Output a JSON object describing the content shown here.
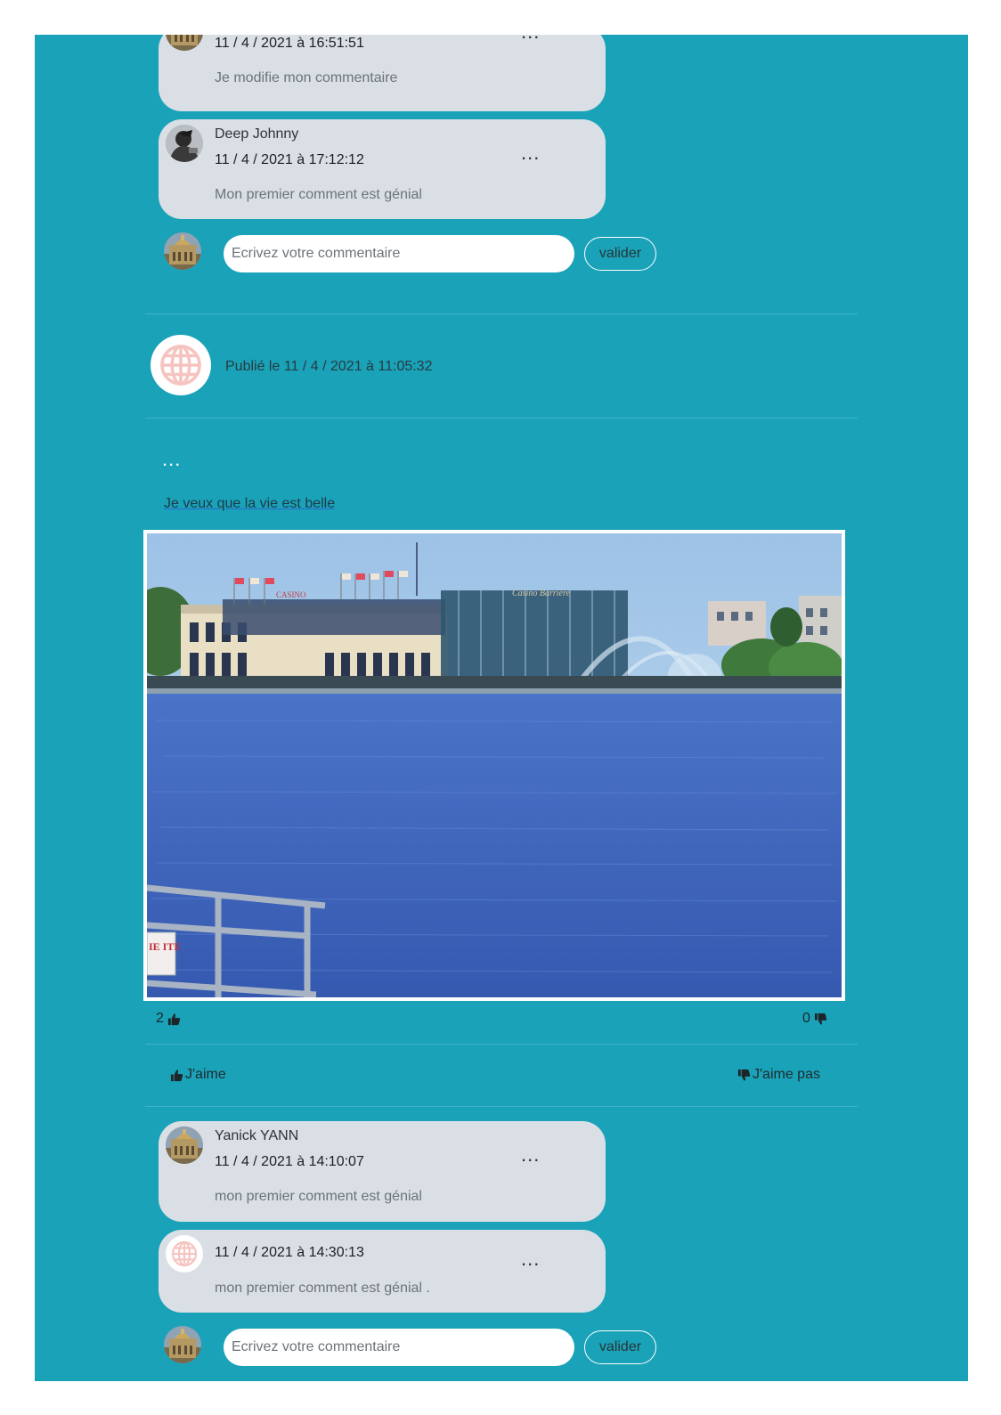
{
  "colors": {
    "feed_bg": "#19a2b8",
    "bubble_bg": "#dadfe5",
    "globe_icon": "#f5c4c0"
  },
  "top_post": {
    "comments": [
      {
        "author": "",
        "avatar": "building-avatar",
        "date": "11 / 4 / 2021 à 16:51:51",
        "text": "Je modifie mon commentaire",
        "menu": "..."
      },
      {
        "author": "Deep Johnny",
        "avatar": "person-avatar",
        "date": "11 / 4 / 2021 à 17:12:12",
        "text": "Mon premier comment est génial",
        "menu": "..."
      }
    ],
    "comment_box": {
      "placeholder": "Ecrivez votre commentaire",
      "submit_label": "valider"
    }
  },
  "post": {
    "published": "Publié le 11 / 4 / 2021 à 11:05:32",
    "menu": "...",
    "text": "Je veux que la vie est belle",
    "image": "lake-casino-photo",
    "likes": "2",
    "dislikes": "0",
    "like_label": "J'aime",
    "dislike_label": "J'aime pas",
    "photo_signs": {
      "building_sign": "CASINO",
      "glass_sign": "Casino Barrière",
      "railing_sign": "IE ITE"
    },
    "comments": [
      {
        "author": "Yanick YANN",
        "avatar": "building-avatar",
        "date": "11 / 4 / 2021 à 14:10:07",
        "text": "mon premier comment est génial",
        "menu": "..."
      },
      {
        "author": "",
        "avatar": "globe-avatar",
        "date": "11 / 4 / 2021 à 14:30:13",
        "text": "mon premier comment est génial .",
        "menu": "..."
      }
    ],
    "comment_box": {
      "placeholder": "Ecrivez votre commentaire",
      "submit_label": "valider"
    }
  }
}
